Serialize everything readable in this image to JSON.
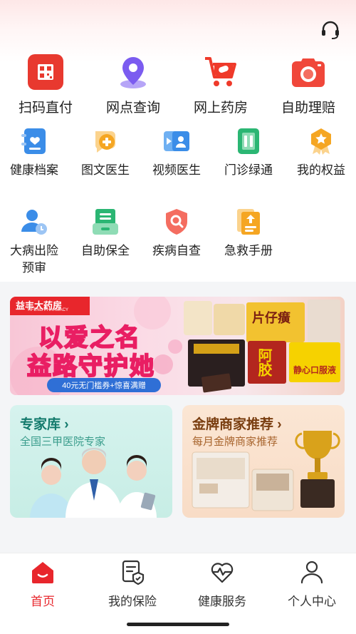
{
  "header": {
    "service_icon": "headset-icon"
  },
  "quick_actions": [
    {
      "label": "扫码直付",
      "icon": "scan-pay-icon",
      "color": "#e8392f"
    },
    {
      "label": "网点查询",
      "icon": "location-pin-icon",
      "color": "#7b5cf0"
    },
    {
      "label": "网上药房",
      "icon": "shopping-cart-icon",
      "color": "#ef3a2a"
    },
    {
      "label": "自助理赔",
      "icon": "camera-icon",
      "color": "#f0473a"
    }
  ],
  "services_row1": [
    {
      "label": "健康档案",
      "icon": "health-record-icon",
      "color": "#3b8de8"
    },
    {
      "label": "图文医生",
      "icon": "chat-doctor-icon",
      "color": "#f5a623"
    },
    {
      "label": "视频医生",
      "icon": "video-doctor-icon",
      "color": "#3b8de8"
    },
    {
      "label": "门诊绿通",
      "icon": "clinic-green-channel-icon",
      "color": "#2bb673"
    },
    {
      "label": "我的权益",
      "icon": "rights-badge-icon",
      "color": "#f5a623"
    }
  ],
  "services_row2": [
    {
      "label": "大病出险\n预审",
      "line1": "大病出险",
      "line2": "预审",
      "icon": "user-review-icon",
      "color": "#3b8de8"
    },
    {
      "label": "自助保全",
      "icon": "self-service-icon",
      "color": "#2bb673"
    },
    {
      "label": "疾病自查",
      "icon": "shield-search-icon",
      "color": "#f0473a"
    },
    {
      "label": "急救手册",
      "icon": "first-aid-manual-icon",
      "color": "#f5a623"
    }
  ],
  "banner": {
    "brand": "益丰大药房",
    "brand_en": "YIFENG PHARMACY",
    "headline1": "以爱之名",
    "headline2": "益路守护她",
    "coupon": "40元无门槛券+惊喜满赠",
    "product1": "片仔癀",
    "product2": "阿胶",
    "product3": "静心口服液"
  },
  "cards": [
    {
      "title": "专家库",
      "subtitle": "全国三甲医院专家"
    },
    {
      "title": "金牌商家推荐",
      "subtitle": "每月金牌商家推荐"
    }
  ],
  "tabbar": [
    {
      "label": "首页",
      "icon": "home-icon",
      "active": true
    },
    {
      "label": "我的保险",
      "icon": "insurance-document-icon",
      "active": false
    },
    {
      "label": "健康服务",
      "icon": "heart-pulse-icon",
      "active": false
    },
    {
      "label": "个人中心",
      "icon": "profile-icon",
      "active": false
    }
  ]
}
